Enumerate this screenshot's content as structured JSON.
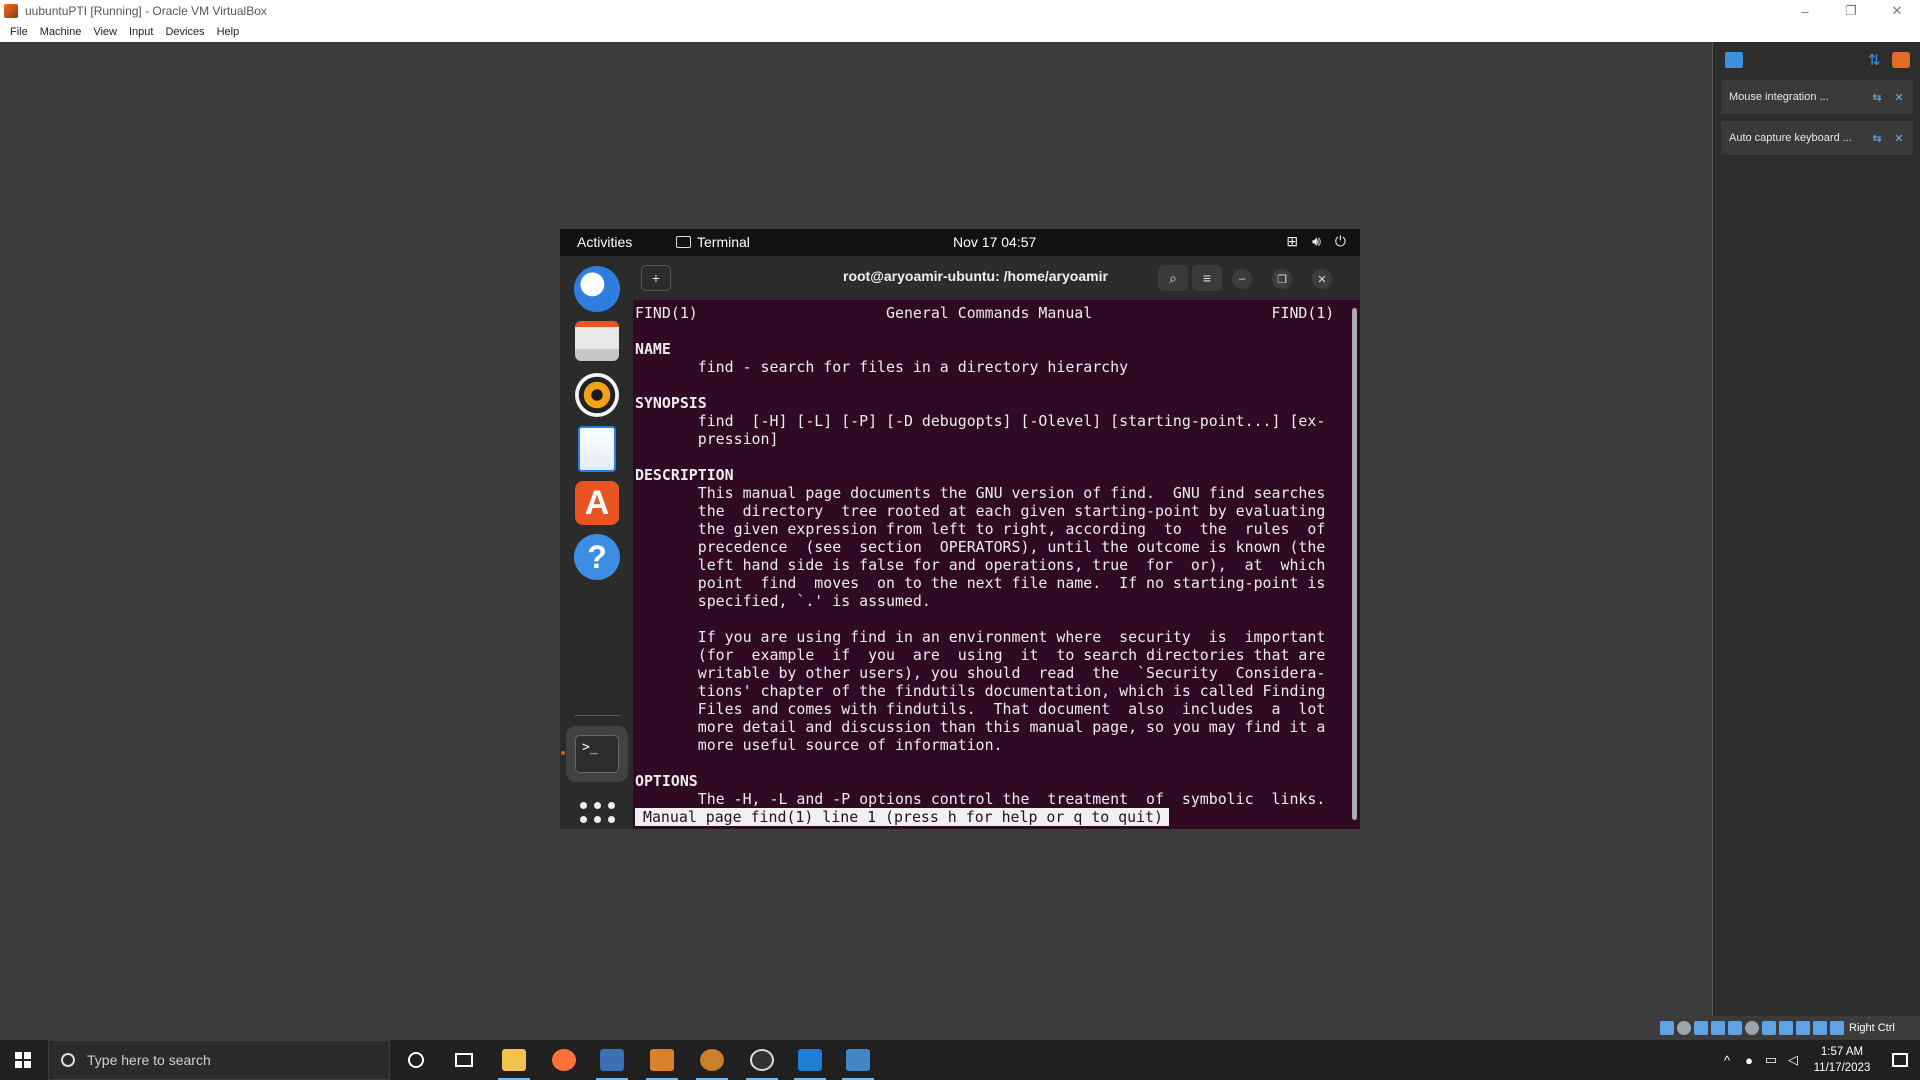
{
  "window": {
    "title": "uubuntuPTI [Running] - Oracle VM VirtualBox",
    "controls": [
      "–",
      "❐",
      "✕"
    ]
  },
  "menubar": [
    "File",
    "Machine",
    "View",
    "Input",
    "Devices",
    "Help"
  ],
  "notifications": [
    {
      "text": "Mouse integration ..."
    },
    {
      "text": "Auto capture keyboard ..."
    }
  ],
  "status_bar": {
    "host_key": "Right Ctrl"
  },
  "ubuntu": {
    "topbar": {
      "activities": "Activities",
      "app_name": "Terminal",
      "clock": "Nov 17  04:57"
    },
    "terminal": {
      "title": "root@aryoamir-ubuntu: /home/aryoamir",
      "lines": [
        "FIND(1)                     General Commands Manual                    FIND(1)",
        "",
        "NAME",
        "       find - search for files in a directory hierarchy",
        "",
        "SYNOPSIS",
        "       find  [-H] [-L] [-P] [-D debugopts] [-Olevel] [starting-point...] [ex‐",
        "       pression]",
        "",
        "DESCRIPTION",
        "       This manual page documents the GNU version of find.  GNU find searches",
        "       the  directory  tree rooted at each given starting-point by evaluating",
        "       the given expression from left to right, according  to  the  rules  of",
        "       precedence  (see  section  OPERATORS), until the outcome is known (the",
        "       left hand side is false for and operations, true  for  or),  at  which",
        "       point  find  moves  on to the next file name.  If no starting-point is",
        "       specified, `.' is assumed.",
        "",
        "       If you are using find in an environment where  security  is  important",
        "       (for  example  if  you  are  using  it  to search directories that are",
        "       writable by other users), you should  read  the  `Security  Considera‐",
        "       tions' chapter of the findutils documentation, which is called Finding",
        "       Files and comes with findutils.  That document  also  includes  a  lot",
        "       more detail and discussion than this manual page, so you may find it a",
        "       more useful source of information.",
        "",
        "OPTIONS",
        "       The -H, -L and -P options control the  treatment  of  symbolic  links."
      ],
      "status_line": "Manual page find(1) line 1 (press h for help or q to quit)"
    }
  },
  "taskbar": {
    "search_placeholder": "Type here to search",
    "time": "1:57 AM",
    "date": "11/17/2023"
  },
  "colors": {
    "terminal_bg": "#300a24",
    "ubuntu_orange": "#e95420",
    "vbox_accent": "#3e8fe0"
  }
}
